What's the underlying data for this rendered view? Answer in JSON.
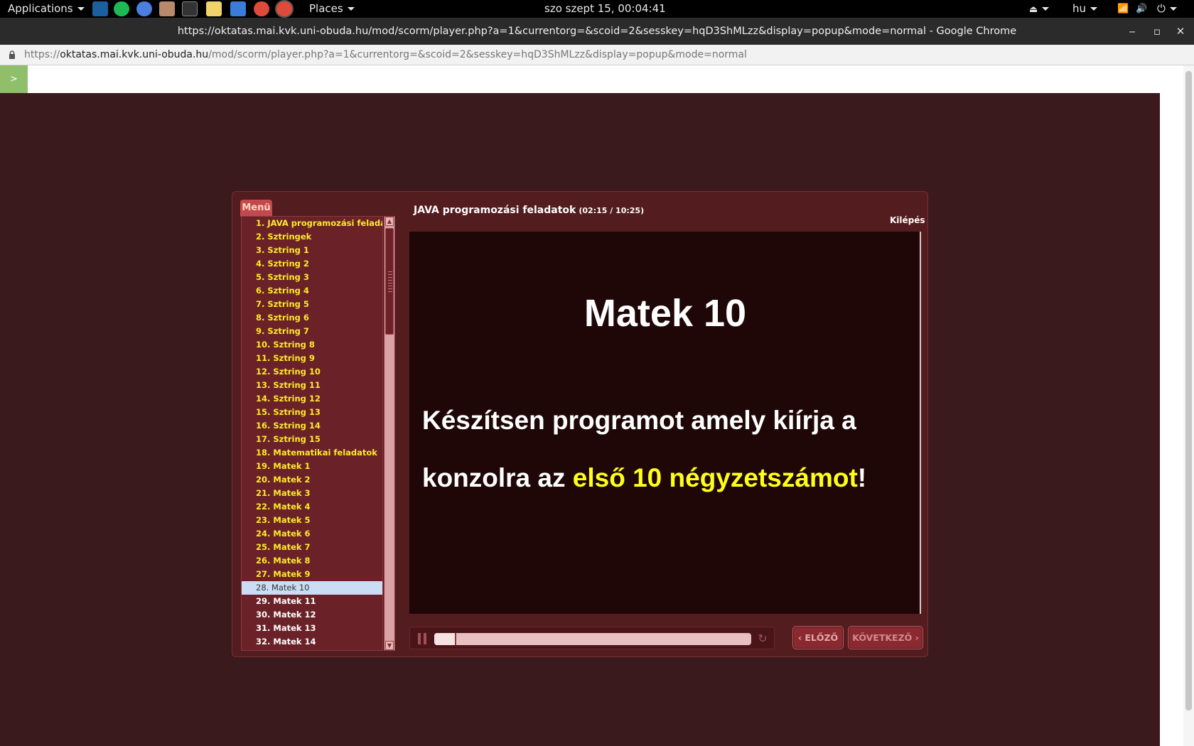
{
  "topbar": {
    "applications": "Applications",
    "places": "Places",
    "clock": "szo szept 15, 00:04:41",
    "language": "hu",
    "launchers": [
      "desktop-icon",
      "spotify-icon",
      "chromium-icon",
      "archive-icon",
      "terminal-icon",
      "text-editor-icon",
      "system-monitor-icon",
      "chrome-icon",
      "chrome-active-icon"
    ]
  },
  "window": {
    "title": "https://oktatas.mai.kvk.uni-obuda.hu/mod/scorm/player.php?a=1&currentorg=&scoid=2&sesskey=hqD3ShMLzz&display=popup&mode=normal - Google Chrome",
    "minimize": "‒",
    "maximize": "▫",
    "close": "✕"
  },
  "address": {
    "scheme": "https://",
    "host": "oktatas.mai.kvk.uni-obuda.hu",
    "path": "/mod/scorm/player.php?a=1&currentorg=&scoid=2&sesskey=hqD3ShMLzz&display=popup&mode=normal"
  },
  "toggle_label": ">",
  "player": {
    "menu_tab": "Menü",
    "course_title": "JAVA programozási feladatok",
    "time": "(02:15 / 10:25)",
    "exit": "Kilépés",
    "progress_fraction": 0.07,
    "prev_label": "‹ ELŐZŐ",
    "next_label": "KÖVETKEZŐ ›",
    "replay_symbol": "↻",
    "colors": {
      "frame": "#531c1e",
      "toc_bg": "#6a2228",
      "toc_text": "#ffea2a",
      "highlight": "#ffff1a",
      "stage": "#1e0706"
    }
  },
  "toc": [
    {
      "label": "1. JAVA programozási felada...",
      "state": "visited"
    },
    {
      "label": "2. Sztringek",
      "state": "visited"
    },
    {
      "label": "3. Sztring 1",
      "state": "visited"
    },
    {
      "label": "4. Sztring 2",
      "state": "visited"
    },
    {
      "label": "5. Sztring 3",
      "state": "visited"
    },
    {
      "label": "6. Sztring  4",
      "state": "visited"
    },
    {
      "label": "7. Sztring 5",
      "state": "visited"
    },
    {
      "label": "8. Sztring 6",
      "state": "visited"
    },
    {
      "label": "9. Sztring 7",
      "state": "visited"
    },
    {
      "label": "10. Sztring 8",
      "state": "visited"
    },
    {
      "label": "11. Sztring 9",
      "state": "visited"
    },
    {
      "label": "12. Sztring 10",
      "state": "visited"
    },
    {
      "label": "13. Sztring 11",
      "state": "visited"
    },
    {
      "label": "14. Sztring 12",
      "state": "visited"
    },
    {
      "label": "15. Sztring 13",
      "state": "visited"
    },
    {
      "label": "16. Sztring 14",
      "state": "visited"
    },
    {
      "label": "17. Sztring 15",
      "state": "visited"
    },
    {
      "label": "18. Matematikai feladatok",
      "state": "visited"
    },
    {
      "label": "19. Matek 1",
      "state": "visited"
    },
    {
      "label": "20. Matek 2",
      "state": "visited"
    },
    {
      "label": "21. Matek 3",
      "state": "visited"
    },
    {
      "label": "22. Matek 4",
      "state": "visited"
    },
    {
      "label": "23. Matek 5",
      "state": "visited"
    },
    {
      "label": "24. Matek 6",
      "state": "visited"
    },
    {
      "label": "25. Matek 7",
      "state": "visited"
    },
    {
      "label": "26. Matek 8",
      "state": "visited"
    },
    {
      "label": "27. Matek 9",
      "state": "visited"
    },
    {
      "label": "28. Matek 10",
      "state": "active"
    },
    {
      "label": "29. Matek 11",
      "state": "unvisited"
    },
    {
      "label": "30. Matek 12",
      "state": "unvisited"
    },
    {
      "label": "31. Matek 13",
      "state": "unvisited"
    },
    {
      "label": "32. Matek 14",
      "state": "unvisited"
    }
  ],
  "slide": {
    "title": "Matek 10",
    "line1": "Készítsen programot amely  kiírja  a",
    "line2_prefix": "konzolra az ",
    "line2_highlight": "első 10 négyzetszámot",
    "line2_suffix": "!"
  }
}
